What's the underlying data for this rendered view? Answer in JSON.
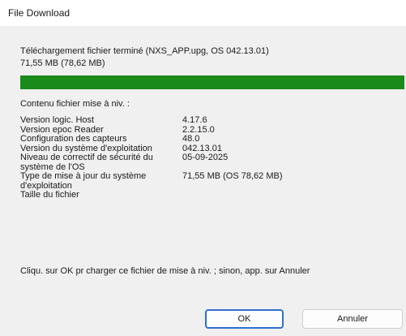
{
  "window": {
    "title": "File Download"
  },
  "message": {
    "line1": "Téléchargement fichier terminé (NXS_APP.upg, OS 042.13.01)",
    "line2": "71,55 MB (78,62 MB)"
  },
  "progress": {
    "fraction": 1.0,
    "color": "#1a8a1a"
  },
  "contents": {
    "heading": "Contenu fichier mise à niv. :",
    "rows": [
      {
        "label": "Version logic. Host",
        "value": "4.17.6"
      },
      {
        "label": "Version epoc Reader",
        "value": "2.2.15.0"
      },
      {
        "label": "Configuration des capteurs",
        "value": "48.0"
      },
      {
        "label": "Version du système d'exploitation",
        "value": "042.13.01"
      },
      {
        "label": "Niveau de correctif de sécurité du système de l'OS",
        "value": "05-09-2025"
      },
      {
        "label": "Type de mise à jour du système d'exploitation",
        "value": "71,55 MB (OS 78,62 MB)"
      },
      {
        "label": "Taille du fichier",
        "value": ""
      }
    ]
  },
  "prompt": "Cliqu. sur OK pr charger ce fichier de mise à niv. ; sinon, app. sur Annuler",
  "buttons": {
    "ok": "OK",
    "cancel": "Annuler"
  }
}
